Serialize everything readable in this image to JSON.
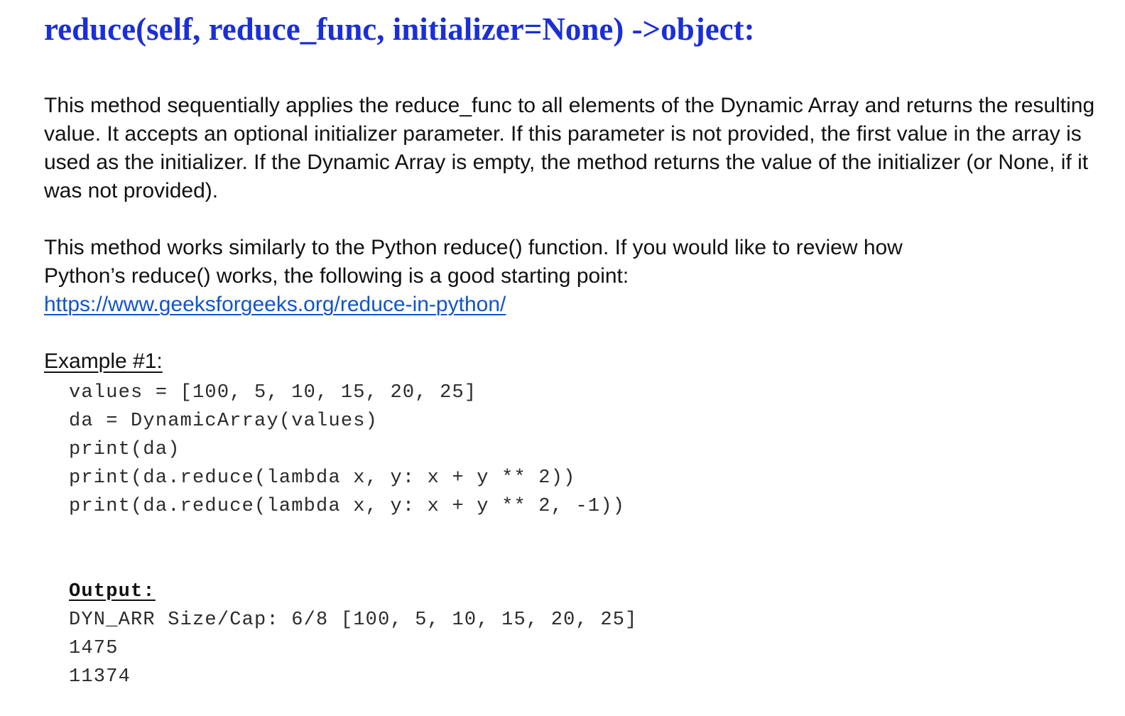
{
  "method": {
    "name": "reduce",
    "signature": "(self, reduce_func, initializer=None) ->object:"
  },
  "description": {
    "paragraph1": "This method sequentially applies the reduce_func to all elements of the Dynamic Array and returns the resulting value. It accepts an optional initializer parameter. If this parameter is not provided, the first value in the array is used as the initializer. If the Dynamic Array is empty, the method returns the value of the initializer (or None, if it was not provided).",
    "paragraph2_line1": "This method works similarly to the Python reduce() function. If you would like to review how",
    "paragraph2_line2": "Python’s reduce() works, the following is a good starting point:",
    "link": "https://www.geeksforgeeks.org/reduce-in-python/"
  },
  "example": {
    "heading": "Example #1:",
    "code": [
      "values = [100, 5, 10, 15, 20, 25]",
      "da = DynamicArray(values)",
      "print(da)",
      "print(da.reduce(lambda x, y: x + y ** 2))",
      "print(da.reduce(lambda x, y: x + y ** 2, -1))"
    ],
    "output_label": "Output:",
    "output": [
      "DYN_ARR Size/Cap: 6/8 [100, 5, 10, 15, 20, 25]",
      "1475",
      "11374"
    ]
  }
}
